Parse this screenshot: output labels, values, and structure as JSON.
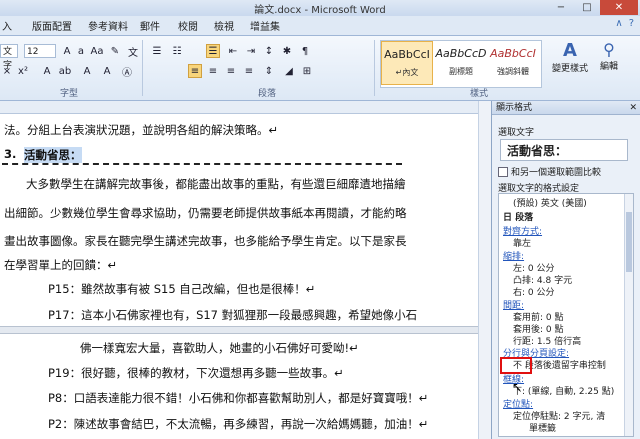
{
  "window": {
    "title": "論文.docx - Microsoft Word",
    "buttons": [
      "−",
      "□",
      "✕"
    ]
  },
  "ribbon_tabs": [
    "入",
    "版面配置",
    "參考資料",
    "郵件",
    "校閱",
    "檢視",
    "增益集"
  ],
  "ribbon": {
    "font_name": "文字",
    "font_size": "12",
    "group_font": "字型",
    "group_paragraph": "段落",
    "group_styles": "樣式",
    "styles": [
      {
        "sample": "AaBbCcI",
        "name": "↵內文"
      },
      {
        "sample": "AaBbCcD",
        "name": "副標題"
      },
      {
        "sample": "AaBbCcI",
        "name": "強調斜體"
      }
    ],
    "change_styles": "變更樣式",
    "editing": "編輯"
  },
  "document": {
    "lines": [
      "法。分組上台表演狀況題，並說明各組的解決策略。↵",
      "3.",
      "活動省思：",
      "大多數學生在講解完故事後，都能盡出故事的重點，有些還巨細靡遺地描繪",
      "出細節。少數幾位學生會尋求協助，仍需要老師提供故事紙本再閱讀，才能約略",
      "畫出故事圖像。家長在聽完學生講述完故事，也多能給予學生肯定。以下是家長",
      "在學習單上的回饋：↵",
      "P15：雖然故事有被 S15 自己改編，但也是很棒！↵",
      "P17：這本小石佛家裡也有，S17 對狐狸那一段最感興趣，希望她像小石",
      "佛一樣寬宏大量，喜歡助人，她畫的小石佛好可愛呦!↵",
      "P19：很好聽，很棒的教材，下次還想再多聽一些故事。↵",
      "P8：口語表達能力很不錯！小石佛和你都喜歡幫助別人，都是好寶寶哦！↵",
      "P2：陳述故事會結巴，不太流暢，再多練習，再說一次給媽媽聽，加油！↵"
    ]
  },
  "pane": {
    "title": "顯示格式",
    "close": "✕",
    "selected_text_label": "選取文字",
    "selected_text": "活動省思：",
    "compare_label": "和另一個選取範圍比較",
    "format_label": "選取文字的格式設定",
    "format_lines": [
      {
        "text": "(預設) 英文 (美國)",
        "kind": "ind"
      },
      {
        "text": "日 段落",
        "kind": "section"
      },
      {
        "text": "對齊方式:",
        "kind": "link"
      },
      {
        "text": "靠左",
        "kind": "ind"
      },
      {
        "text": "縮排:",
        "kind": "link"
      },
      {
        "text": "左:  0 公分",
        "kind": "ind"
      },
      {
        "text": "凸排:  4.8 字元",
        "kind": "ind"
      },
      {
        "text": "右:  0 公分",
        "kind": "ind"
      },
      {
        "text": "間距:",
        "kind": "link"
      },
      {
        "text": "套用前:  0 點",
        "kind": "ind"
      },
      {
        "text": "套用後:  0 點",
        "kind": "ind"
      },
      {
        "text": "行距:  1.5 倍行高",
        "kind": "ind"
      },
      {
        "text": "分行與分頁設定:",
        "kind": "link"
      },
      {
        "text": "不 段落後遺留字串控制",
        "kind": "ind"
      },
      {
        "text": "框線:",
        "kind": "link"
      },
      {
        "text": "下: (單線, 自動,  2.25 點)",
        "kind": "ind"
      },
      {
        "text": "定位點:",
        "kind": "link"
      },
      {
        "text": "定位停駐點:  2 字元, 清",
        "kind": "ind"
      },
      {
        "text": "單標籤",
        "kind": "ind"
      }
    ]
  }
}
